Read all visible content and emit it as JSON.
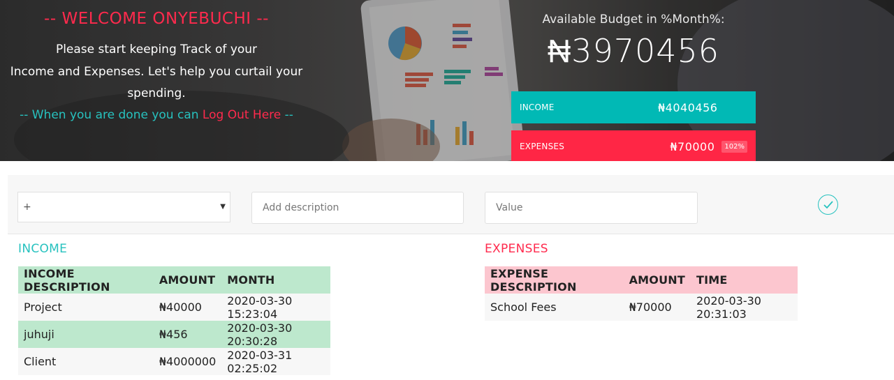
{
  "header": {
    "welcome": "-- WELCOME ONYEBUCHI --",
    "intro_line1": "Please start keeping Track of your",
    "intro_line2": "Income and Expenses. Let's help you curtail your",
    "intro_line3": "spending.",
    "logout_prefix": "-- When you are done you can ",
    "logout_link": "Log Out Here",
    "logout_suffix": " --"
  },
  "budget": {
    "title": "Available Budget in %Month%:",
    "value": "₦3970456"
  },
  "summary": {
    "income_label": "INCOME",
    "income_value": "₦4040456",
    "expenses_label": "EXPENSES",
    "expenses_value": "₦70000",
    "expenses_percent": "102%"
  },
  "add_form": {
    "type_value": "+",
    "description_placeholder": "Add description",
    "value_placeholder": "Value",
    "submit_icon": "check-circle-icon"
  },
  "income": {
    "title": "INCOME",
    "headers": [
      "INCOME DESCRIPTION",
      "AMOUNT",
      "MONTH"
    ],
    "rows": [
      [
        "Project",
        "₦40000",
        "2020-03-30 15:23:04"
      ],
      [
        "juhuji",
        "₦456",
        "2020-03-30 20:30:28"
      ],
      [
        "Client",
        "₦4000000",
        "2020-03-31 02:25:02"
      ]
    ]
  },
  "expenses": {
    "title": "EXPENSES",
    "headers": [
      "EXPENSE DESCRIPTION",
      "AMOUNT",
      "TIME"
    ],
    "rows": [
      [
        "School Fees",
        "₦70000",
        "2020-03-30 20:31:03"
      ]
    ]
  },
  "colors": {
    "accent_teal": "#27c2bf",
    "accent_red": "#ff2a4d",
    "income_row_green": "#bde8cd",
    "expense_header_pink": "#fcc6cf"
  }
}
